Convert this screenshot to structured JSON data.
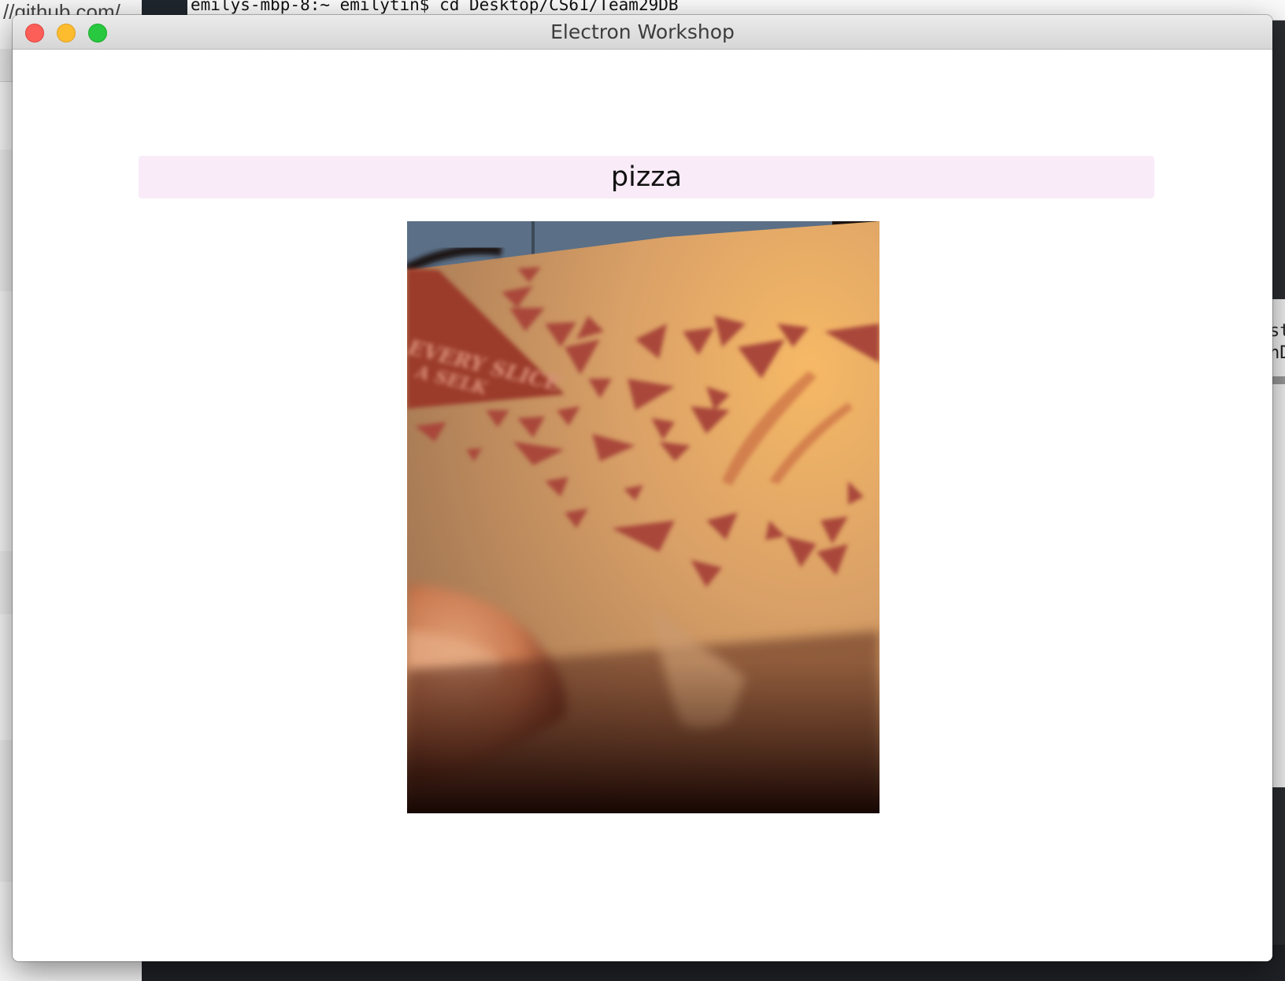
{
  "background": {
    "browser_url_fragment": "//github.com/",
    "terminal_prompt": "emilys-mbp-8:~ emilytin$ cd Desktop/CS61/Team29DB",
    "right_fragments": [
      "st",
      "nD"
    ]
  },
  "window": {
    "title": "Electron Workshop"
  },
  "search": {
    "value": "pizza"
  },
  "result_image": {
    "alt": "pizza box photo",
    "printed_text": [
      "EVERY SLICE",
      "A SELK"
    ]
  },
  "colors": {
    "search_background": "#f9ebf7",
    "close": "#fc5f57",
    "minimize": "#fdbc2e",
    "zoom": "#28c840"
  }
}
